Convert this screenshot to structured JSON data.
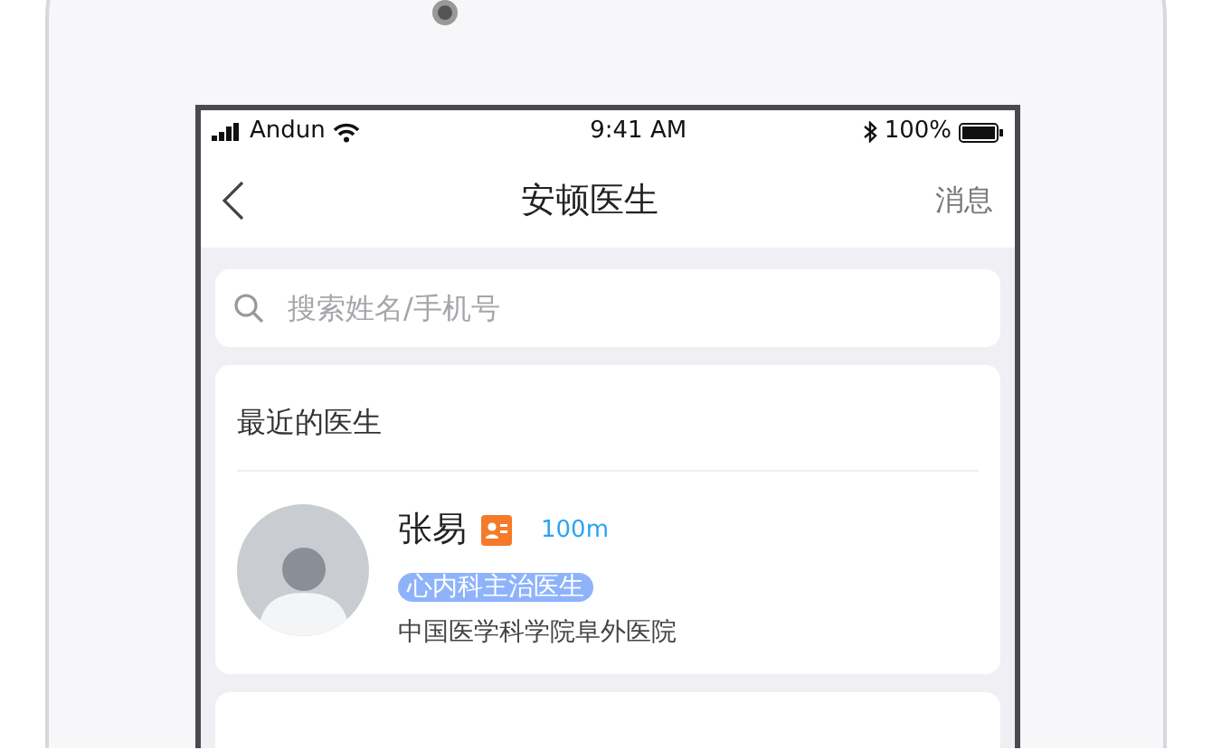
{
  "status_bar": {
    "carrier": "Andun",
    "time": "9:41 AM",
    "battery": "100%"
  },
  "nav_bar": {
    "title": "安顿医生",
    "action": "消息"
  },
  "search": {
    "placeholder": "搜索姓名/手机号"
  },
  "recent": {
    "title": "最近的医生",
    "doctors": [
      {
        "name": "张易",
        "distance": "100m",
        "tag": "心内科主治医生",
        "hospital": "中国医学科学院阜外医院"
      }
    ]
  }
}
